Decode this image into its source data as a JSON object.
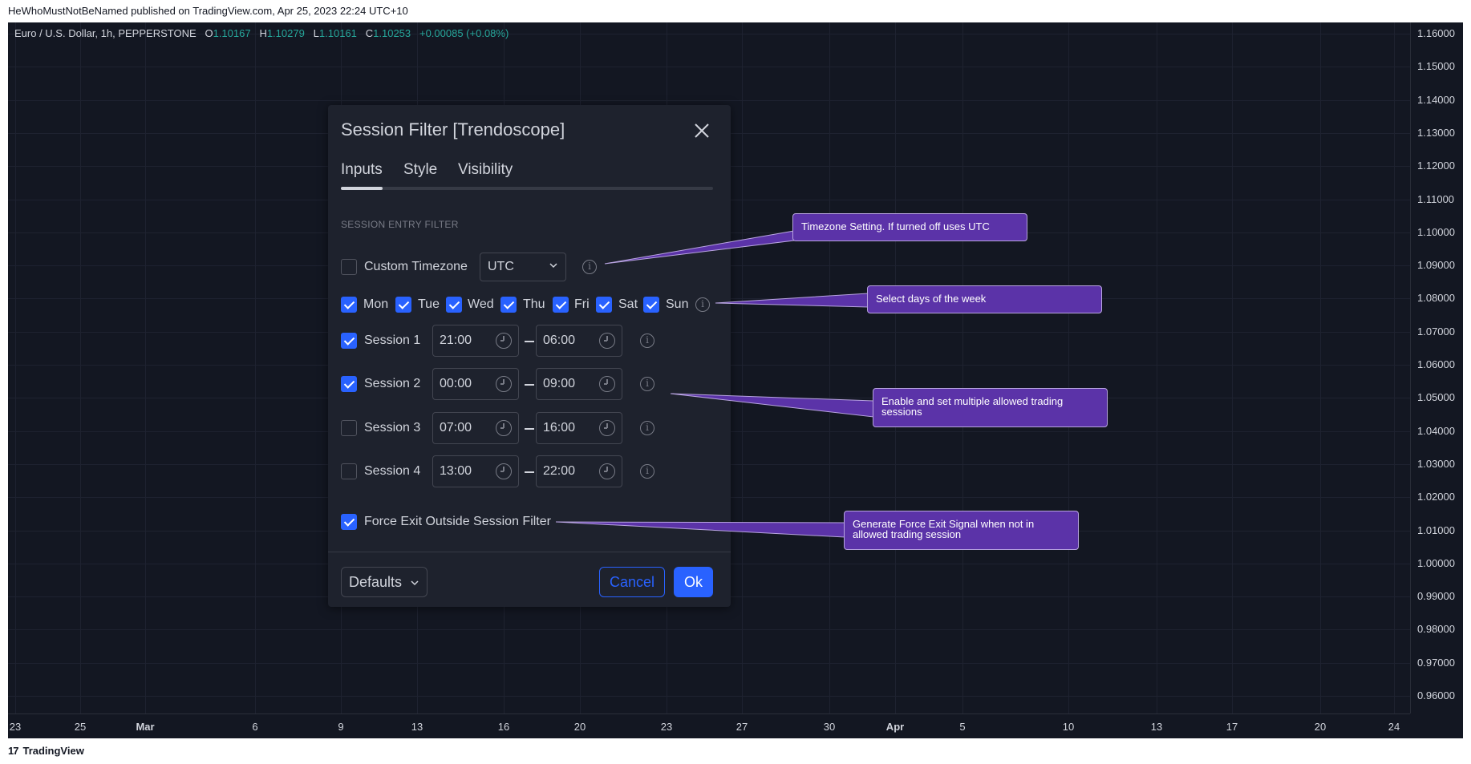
{
  "header": {
    "published_line": "HeWhoMustNotBeNamed published on TradingView.com, Apr 25, 2023 22:24 UTC+10"
  },
  "legend": {
    "symbol": "Euro / U.S. Dollar, 1h, PEPPERSTONE",
    "o_label": "O",
    "o_value": "1.10167",
    "h_label": "H",
    "h_value": "1.10279",
    "l_label": "L",
    "l_value": "1.10161",
    "c_label": "C",
    "c_value": "1.10253",
    "change": "+0.00085 (+0.08%)"
  },
  "price_axis": [
    "1.16000",
    "1.15000",
    "1.14000",
    "1.13000",
    "1.12000",
    "1.11000",
    "1.10000",
    "1.09000",
    "1.08000",
    "1.07000",
    "1.06000",
    "1.05000",
    "1.04000",
    "1.03000",
    "1.02000",
    "1.01000",
    "1.00000",
    "0.99000",
    "0.98000",
    "0.97000",
    "0.96000"
  ],
  "time_axis": [
    {
      "label": "23",
      "bold": false
    },
    {
      "label": "25",
      "bold": false
    },
    {
      "label": "Mar",
      "bold": true
    },
    {
      "label": "6",
      "bold": false
    },
    {
      "label": "9",
      "bold": false
    },
    {
      "label": "13",
      "bold": false
    },
    {
      "label": "16",
      "bold": false
    },
    {
      "label": "20",
      "bold": false
    },
    {
      "label": "23",
      "bold": false
    },
    {
      "label": "27",
      "bold": false
    },
    {
      "label": "30",
      "bold": false
    },
    {
      "label": "Apr",
      "bold": true
    },
    {
      "label": "5",
      "bold": false
    },
    {
      "label": "10",
      "bold": false
    },
    {
      "label": "13",
      "bold": false
    },
    {
      "label": "17",
      "bold": false
    },
    {
      "label": "20",
      "bold": false
    },
    {
      "label": "24",
      "bold": false
    }
  ],
  "footer": {
    "brand": "TradingView",
    "brand_mark": "17"
  },
  "dialog": {
    "title": "Session Filter [Trendoscope]",
    "close_icon": "close-icon",
    "tabs": [
      {
        "label": "Inputs",
        "active": true
      },
      {
        "label": "Style",
        "active": false
      },
      {
        "label": "Visibility",
        "active": false
      }
    ],
    "section_label": "SESSION ENTRY FILTER",
    "custom_timezone": {
      "label": "Custom Timezone",
      "checked": false,
      "value": "UTC"
    },
    "days": [
      {
        "label": "Mon",
        "checked": true
      },
      {
        "label": "Tue",
        "checked": true
      },
      {
        "label": "Wed",
        "checked": true
      },
      {
        "label": "Thu",
        "checked": true
      },
      {
        "label": "Fri",
        "checked": true
      },
      {
        "label": "Sat",
        "checked": true
      },
      {
        "label": "Sun",
        "checked": true
      }
    ],
    "sessions": [
      {
        "label": "Session 1",
        "checked": true,
        "start": "21:00",
        "end": "06:00"
      },
      {
        "label": "Session 2",
        "checked": true,
        "start": "00:00",
        "end": "09:00"
      },
      {
        "label": "Session 3",
        "checked": false,
        "start": "07:00",
        "end": "16:00"
      },
      {
        "label": "Session 4",
        "checked": false,
        "start": "13:00",
        "end": "22:00"
      }
    ],
    "force_exit": {
      "label": "Force Exit Outside Session Filter",
      "checked": true
    },
    "defaults_label": "Defaults",
    "cancel_label": "Cancel",
    "ok_label": "Ok",
    "accent_color": "#2962ff"
  },
  "callouts": {
    "timezone": "Timezone Setting. If turned off uses UTC",
    "days": "Select days of the week",
    "sessions_line1": "Enable and set multiple allowed trading",
    "sessions_line2": "sessions",
    "force_exit_line1": "Generate Force Exit Signal when not in",
    "force_exit_line2": "allowed trading session",
    "color": "#5b33a8"
  }
}
